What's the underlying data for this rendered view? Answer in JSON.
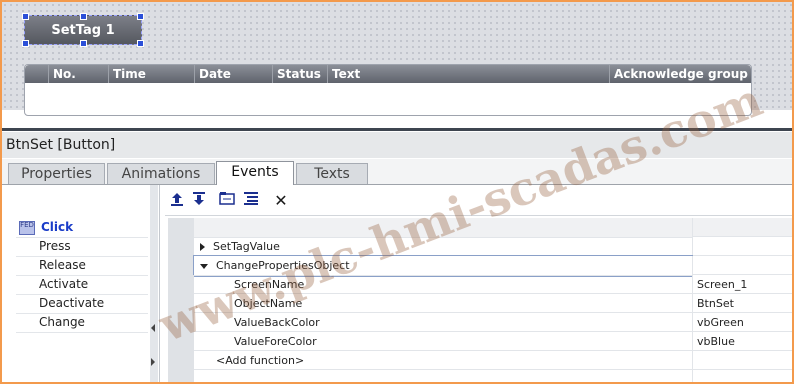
{
  "canvas": {
    "button_label": "SetTag 1",
    "alarm_columns": [
      "No.",
      "Time",
      "Date",
      "Status",
      "Text",
      "Acknowledge group"
    ]
  },
  "inspector": {
    "title": "BtnSet [Button]",
    "tabs": [
      "Properties",
      "Animations",
      "Events",
      "Texts"
    ],
    "active_tab": "Events"
  },
  "events": {
    "items": [
      "Click",
      "Press",
      "Release",
      "Activate",
      "Deactivate",
      "Change"
    ],
    "selected": "Click",
    "click_icon_text": "FED"
  },
  "toolbar": {
    "icons": [
      "move-up-icon",
      "move-down-icon",
      "folder-icon",
      "list-icon",
      "delete-icon"
    ],
    "delete_glyph": "✕"
  },
  "function_list": {
    "rows": [
      {
        "indent": 0,
        "expander": "collapsed",
        "name": "SetTagValue",
        "value": ""
      },
      {
        "indent": 0,
        "expander": "expanded",
        "name": "ChangePropertiesObject",
        "value": ""
      },
      {
        "indent": 1,
        "expander": "none",
        "name": "ScreenName",
        "value": "Screen_1"
      },
      {
        "indent": 1,
        "expander": "none",
        "name": "ObjectName",
        "value": "BtnSet"
      },
      {
        "indent": 1,
        "expander": "none",
        "name": "ValueBackColor",
        "value": "vbGreen"
      },
      {
        "indent": 1,
        "expander": "none",
        "name": "ValueForeColor",
        "value": "vbBlue"
      },
      {
        "indent": 0,
        "expander": "none",
        "name": "<Add function>",
        "value": ""
      }
    ]
  },
  "watermark": "www.plc-hmi-scadas.com",
  "colors": {
    "frame": "#f39a4c",
    "selection": "#1a3cc8"
  }
}
